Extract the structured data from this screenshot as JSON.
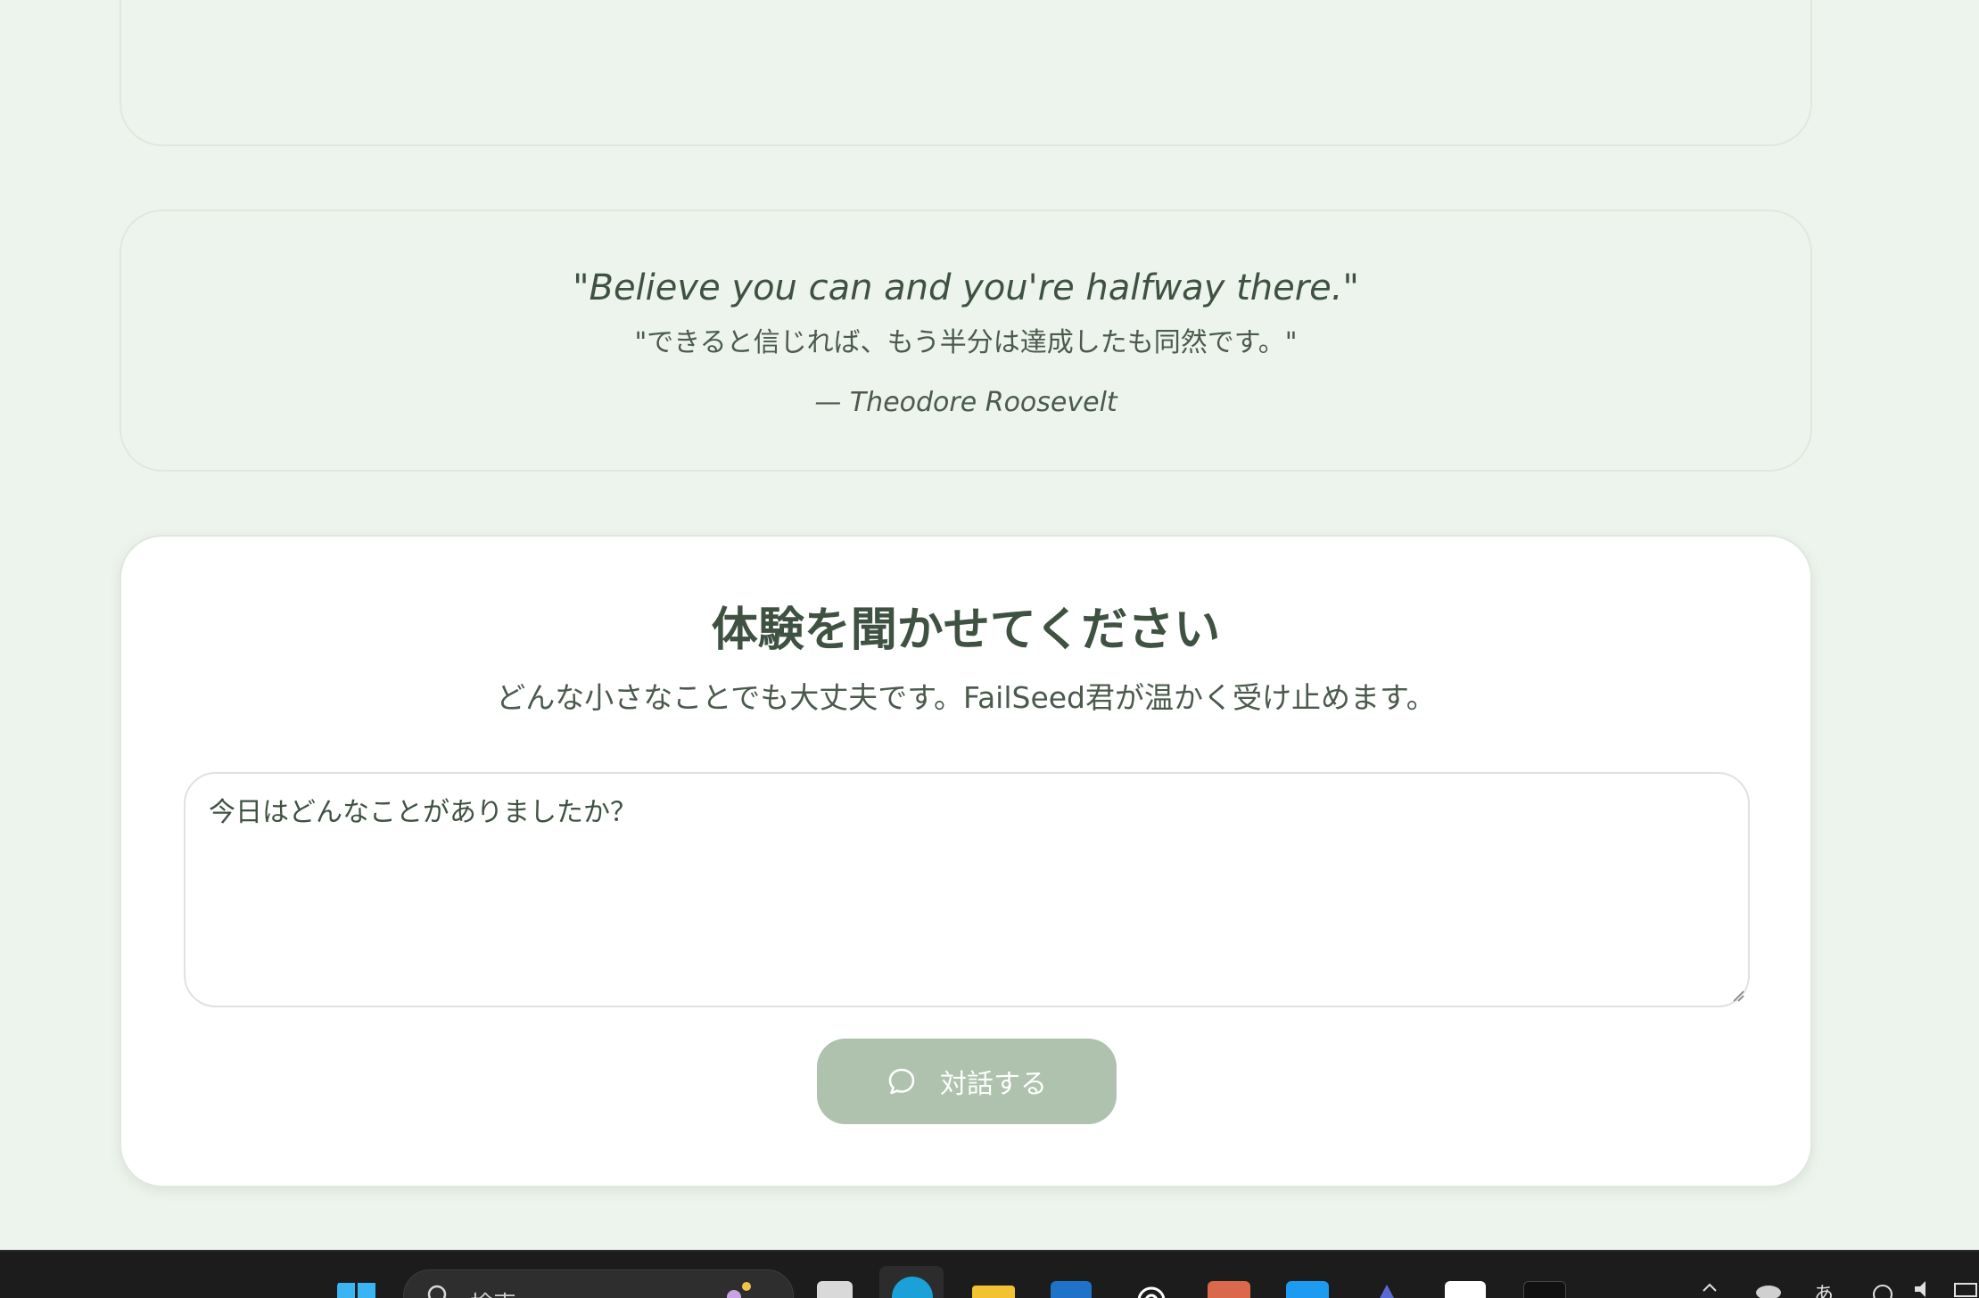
{
  "quote": {
    "english": "\"Believe you can and you're halfway there.\"",
    "japanese": "\"できると信じれば、もう半分は達成したも同然です。\"",
    "author": "— Theodore Roosevelt"
  },
  "form": {
    "title": "体験を聞かせてください",
    "subtitle": "どんな小さなことでも大丈夫です。FailSeed君が温かく受け止めます。",
    "textarea_placeholder": "今日はどんなことがありましたか？",
    "textarea_value": "",
    "submit_label": "対話する",
    "submit_icon": "chat-bubble-icon"
  },
  "taskbar": {
    "search_placeholder": "検索",
    "ime_indicator": "あ",
    "apps": [
      "windows-start-icon",
      "search-icon",
      "task-view-icon",
      "edge-icon",
      "file-explorer-icon",
      "outlook-icon",
      "chatgpt-icon",
      "claude-icon",
      "twitter-icon",
      "vscode-icon",
      "note-icon",
      "clipboard-icon"
    ]
  },
  "colors": {
    "page_bg": "#edf4ed",
    "text_primary": "#3f5242",
    "button_bg": "#aec2ae",
    "card_bg": "#ffffff"
  }
}
